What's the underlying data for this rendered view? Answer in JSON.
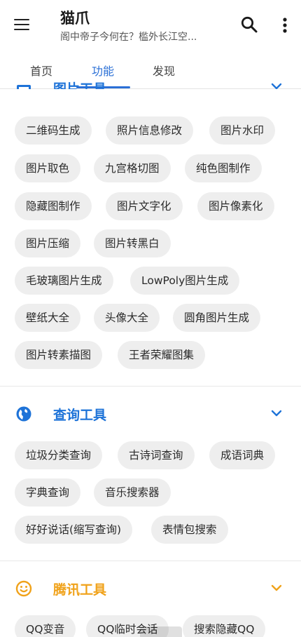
{
  "app": {
    "title": "猫爪",
    "subtitle": "阁中帝子今何在？槛外长江空..."
  },
  "tabs": [
    {
      "label": "首页"
    },
    {
      "label": "功能"
    },
    {
      "label": "发现"
    }
  ],
  "sections": {
    "image_tools": {
      "title": "图片工具",
      "chips": [
        "二维码生成",
        "照片信息修改",
        "图片水印",
        "图片取色",
        "九宫格切图",
        "纯色图制作",
        "隐藏图制作",
        "图片文字化",
        "图片像素化",
        "图片压缩",
        "图片转黑白",
        "毛玻璃图片生成",
        "LowPoly图片生成",
        "壁纸大全",
        "头像大全",
        "圆角图片生成",
        "图片转素描图",
        "王者荣耀图集"
      ]
    },
    "query_tools": {
      "title": "查询工具",
      "chips": [
        "垃圾分类查询",
        "古诗词查询",
        "成语词典",
        "字典查询",
        "音乐搜索器",
        "好好说话(缩写查询)",
        "表情包搜索"
      ]
    },
    "tencent_tools": {
      "title": "腾讯工具",
      "chips": [
        "QQ变音",
        "QQ临时会话",
        "搜索隐藏QQ"
      ]
    }
  },
  "colors": {
    "accent": "#2a6fd6",
    "section_blue": "#1e73d8",
    "section_orange": "#f0a21a",
    "chip_bg": "#eeeeee"
  },
  "icons": {
    "menu": "hamburger-icon",
    "search": "search-icon",
    "more": "more-vertical-icon",
    "image_section": "image-icon",
    "query_section": "globe-icon",
    "tencent_section": "smiley-icon",
    "expand": "chevron-down-icon"
  }
}
